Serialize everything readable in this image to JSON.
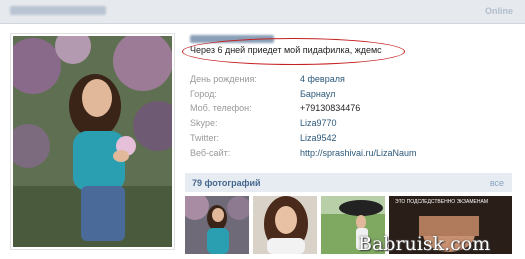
{
  "header": {
    "online_label": "Online"
  },
  "profile": {
    "status": "Через 6 дней приедет мой пидафилка, ждемс",
    "info": [
      {
        "label": "День рождения:",
        "value": "4 февраля",
        "link": true
      },
      {
        "label": "Город:",
        "value": "Барнаул",
        "link": true
      },
      {
        "label": "Моб. телефон:",
        "value": "+79130834476",
        "link": false
      },
      {
        "label": "Skype:",
        "value": "Liza9770",
        "link": true
      },
      {
        "label": "Twitter:",
        "value": "Liza9542",
        "link": true
      },
      {
        "label": "Веб-сайт:",
        "value": "http://sprashivai.ru/LizaNaum",
        "link": true
      }
    ]
  },
  "photos": {
    "title": "79 фотографий",
    "all_label": "все",
    "thumb_caption": "ЭТО ПОДСЛЕДСТВЕННО ЭКЗАМЕНАМ"
  },
  "watermark": "Babruisk.com",
  "colors": {
    "link": "#2b587a",
    "accent_bar": "#e7ecf2",
    "oval": "#c51f1f"
  }
}
